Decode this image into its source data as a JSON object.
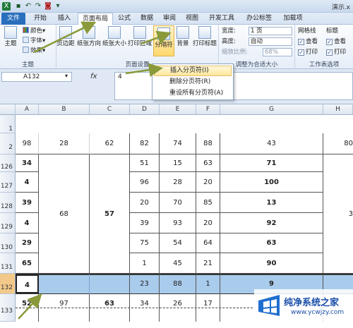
{
  "window": {
    "title": "演示.x"
  },
  "tabs": [
    "文件",
    "开始",
    "插入",
    "页面布局",
    "公式",
    "数据",
    "审阅",
    "视图",
    "开发工具",
    "办公标签",
    "加载项"
  ],
  "ribbon": {
    "theme": {
      "big": "主题",
      "colors": "颜色",
      "fonts": "字体",
      "effects": "效果",
      "group": "主题"
    },
    "page_setup": {
      "margins": "页边距",
      "orientation": "纸张方向",
      "size": "纸张大小",
      "print_area": "打印区域",
      "breaks": "分隔符",
      "background": "背景",
      "print_titles": "打印标题",
      "group": "页面设置"
    },
    "scale": {
      "width_label": "宽度:",
      "width_value": "1 页",
      "height_label": "高度:",
      "height_value": "自动",
      "scale_label": "缩放比例:",
      "scale_value": "68%",
      "group": "调整为合适大小"
    },
    "sheet_options": {
      "gridlines": "网格线",
      "headings": "标题",
      "view": "查看",
      "print": "打印",
      "group": "工作表选项"
    }
  },
  "formula_bar": {
    "name_box": "A132",
    "fx": "fx",
    "value": "4"
  },
  "breaks_menu": {
    "items": [
      "插入分页符(I)",
      "删除分页符(R)",
      "重设所有分页符(A)"
    ]
  },
  "columns": [
    "A",
    "B",
    "C",
    "D",
    "E",
    "F",
    "G",
    "H"
  ],
  "rows": {
    "r1": "1",
    "r2": "2",
    "r126": "126",
    "r127": "127",
    "r128": "128",
    "r129": "129",
    "r130": "130",
    "r131": "131",
    "r132": "132",
    "r133": "133"
  },
  "row2": {
    "a": "98",
    "b": "28",
    "c": "62",
    "d": "82",
    "e": "74",
    "f": "88",
    "g": "43",
    "h": "80"
  },
  "row126": {
    "a": "34",
    "d": "51",
    "e": "15",
    "f": "63",
    "g": "71"
  },
  "row127": {
    "a": "4",
    "d": "96",
    "e": "28",
    "f": "20",
    "g": "100"
  },
  "row128": {
    "a": "39",
    "b": "68",
    "c": "57",
    "d": "20",
    "e": "70",
    "f": "85",
    "g": "13",
    "h": "3"
  },
  "row129": {
    "a": "4",
    "d": "39",
    "e": "93",
    "f": "20",
    "g": "92"
  },
  "row130": {
    "a": "29",
    "d": "75",
    "e": "54",
    "f": "64",
    "g": "63"
  },
  "row131": {
    "a": "65",
    "d": "1",
    "e": "45",
    "f": "21",
    "g": "90"
  },
  "row132": {
    "a": "4",
    "d": "23",
    "e": "88",
    "f": "1",
    "g": "9"
  },
  "row133": {
    "a": "52",
    "b": "97",
    "c": "63",
    "d": "34",
    "e": "26",
    "f": "17"
  },
  "watermark": {
    "brand": "纯净系统之家",
    "url": "www.ycwjzy.com"
  },
  "colors": {
    "accent": "#2a6fbd",
    "selection": "#a9cbec",
    "arrow": "#8a9a3a"
  }
}
